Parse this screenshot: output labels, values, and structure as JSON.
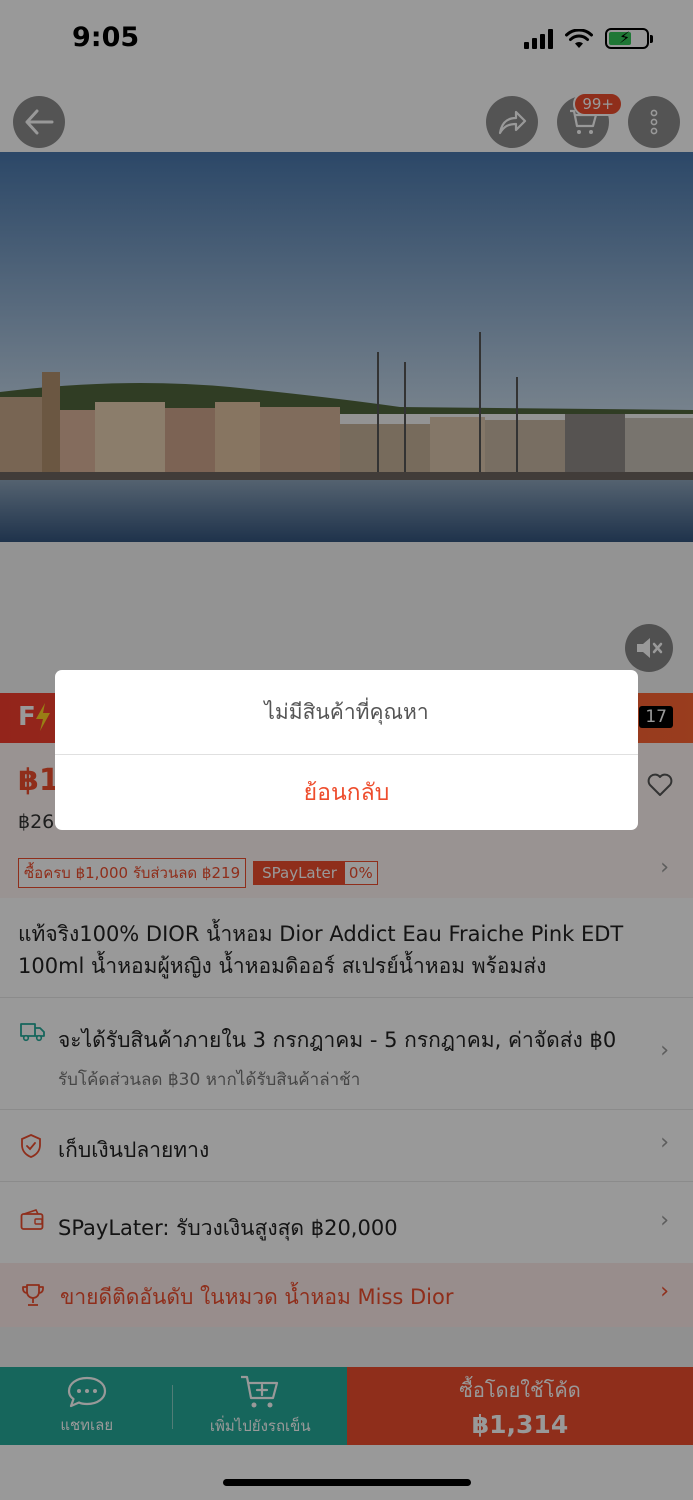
{
  "status_bar": {
    "time": "9:05"
  },
  "top_nav": {
    "cart_badge": "99+"
  },
  "flash_sale": {
    "logo": "F",
    "countdown": "17"
  },
  "price": {
    "current": "฿1,",
    "original": "฿26",
    "promo_tag": "ซื้อครบ ฿1,000 รับส่วนลด ฿219",
    "spaylater_label": "SPayLater",
    "spaylater_rate": "0%"
  },
  "product": {
    "title": "แท้จริง100% DIOR น้ำหอม Dior Addict Eau Fraiche Pink EDT 100ml น้ำหอมผู้หญิง น้ำหอมดิออร์ สเปรย์น้ำหอม พร้อมส่ง"
  },
  "shipping": {
    "text": "จะได้รับสินค้าภายใน 3 กรกฎาคม - 5 กรกฎาคม, ค่าจัดส่ง ฿0",
    "sub": "รับโค้ดส่วนลด ฿30 หากได้รับสินค้าล่าช้า"
  },
  "cod": {
    "text": "เก็บเงินปลายทาง"
  },
  "spaylater": {
    "text": "SPayLater: รับวงเงินสูงสุด ฿20,000"
  },
  "bestseller": {
    "text": "ขายดีติดอันดับ ในหมวด น้ำหอม Miss Dior"
  },
  "bottom_bar": {
    "chat_label": "แชทเลย",
    "add_cart_label": "เพิ่มไปยังรถเข็น",
    "buy_line1": "ซื้อโดยใช้โค้ด",
    "buy_price": "฿1,314"
  },
  "dialog": {
    "message": "ไม่มีสินค้าที่คุณหา",
    "button": "ย้อนกลับ"
  },
  "colors": {
    "brand": "#ee4d2d",
    "teal": "#26aa99"
  }
}
